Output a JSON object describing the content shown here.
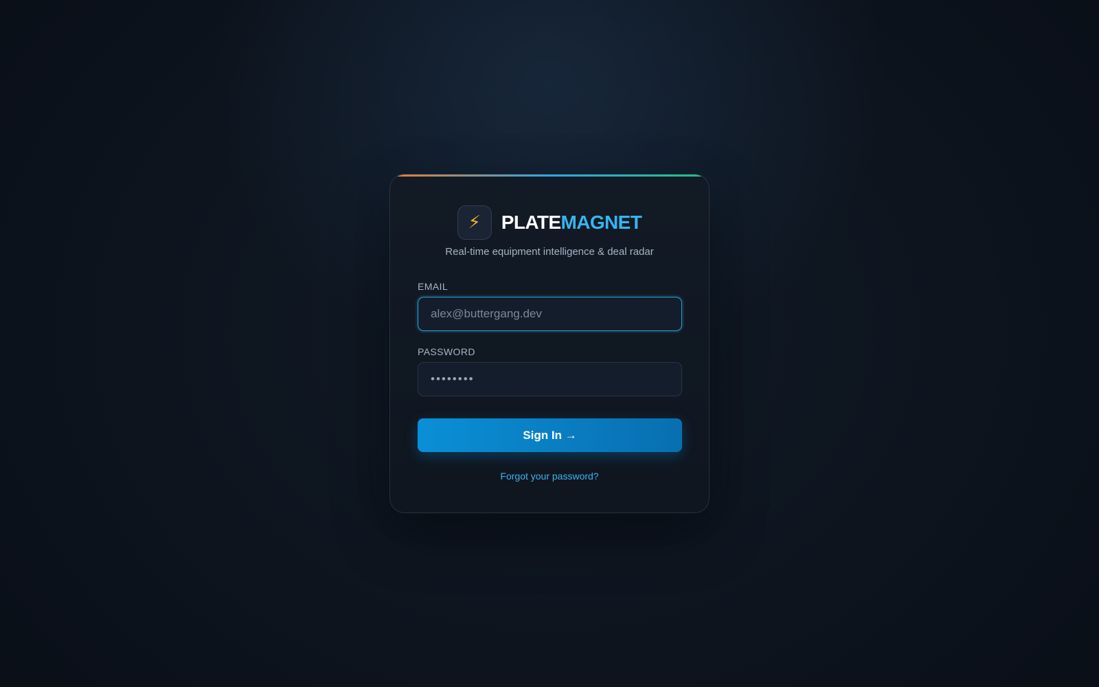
{
  "brand": {
    "icon": "lightning-bolt-icon",
    "icon_glyph": "⚡",
    "name_part1": "PLATE",
    "name_part2": "MAGNET",
    "tagline": "Real-time equipment intelligence & deal radar"
  },
  "form": {
    "email_label": "EMAIL",
    "email_placeholder": "alex@buttergang.dev",
    "email_value": "",
    "password_label": "PASSWORD",
    "password_value": "••••••••",
    "submit_label": "Sign In →",
    "forgot_label": "Forgot your password?"
  },
  "colors": {
    "accent": "#38b4f0",
    "button": "#0a8fd6",
    "bar_start": "#f07a2d",
    "bar_mid": "#2aa8e6",
    "bar_end": "#22c17d"
  }
}
